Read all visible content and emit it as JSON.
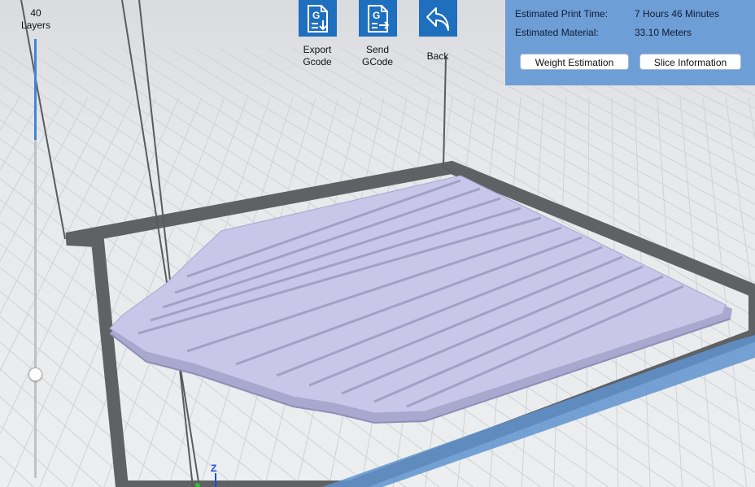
{
  "layer_slider": {
    "count": "40",
    "unit": "Layers",
    "position_fraction": 0.77
  },
  "toolbar": {
    "export_label": "Export\nGcode",
    "send_label": "Send\nGCode",
    "back_label": "Back",
    "accent_color": "#1f6fbf"
  },
  "info": {
    "print_time_label": "Estimated Print Time:",
    "print_time_value": "7 Hours 46 Minutes",
    "material_label": "Estimated Material:",
    "material_value": "33.10 Meters",
    "weight_button": "Weight Estimation",
    "slice_button": "Slice Information",
    "panel_color": "#6e9ed6"
  },
  "axes": {
    "z_label": "Z"
  }
}
